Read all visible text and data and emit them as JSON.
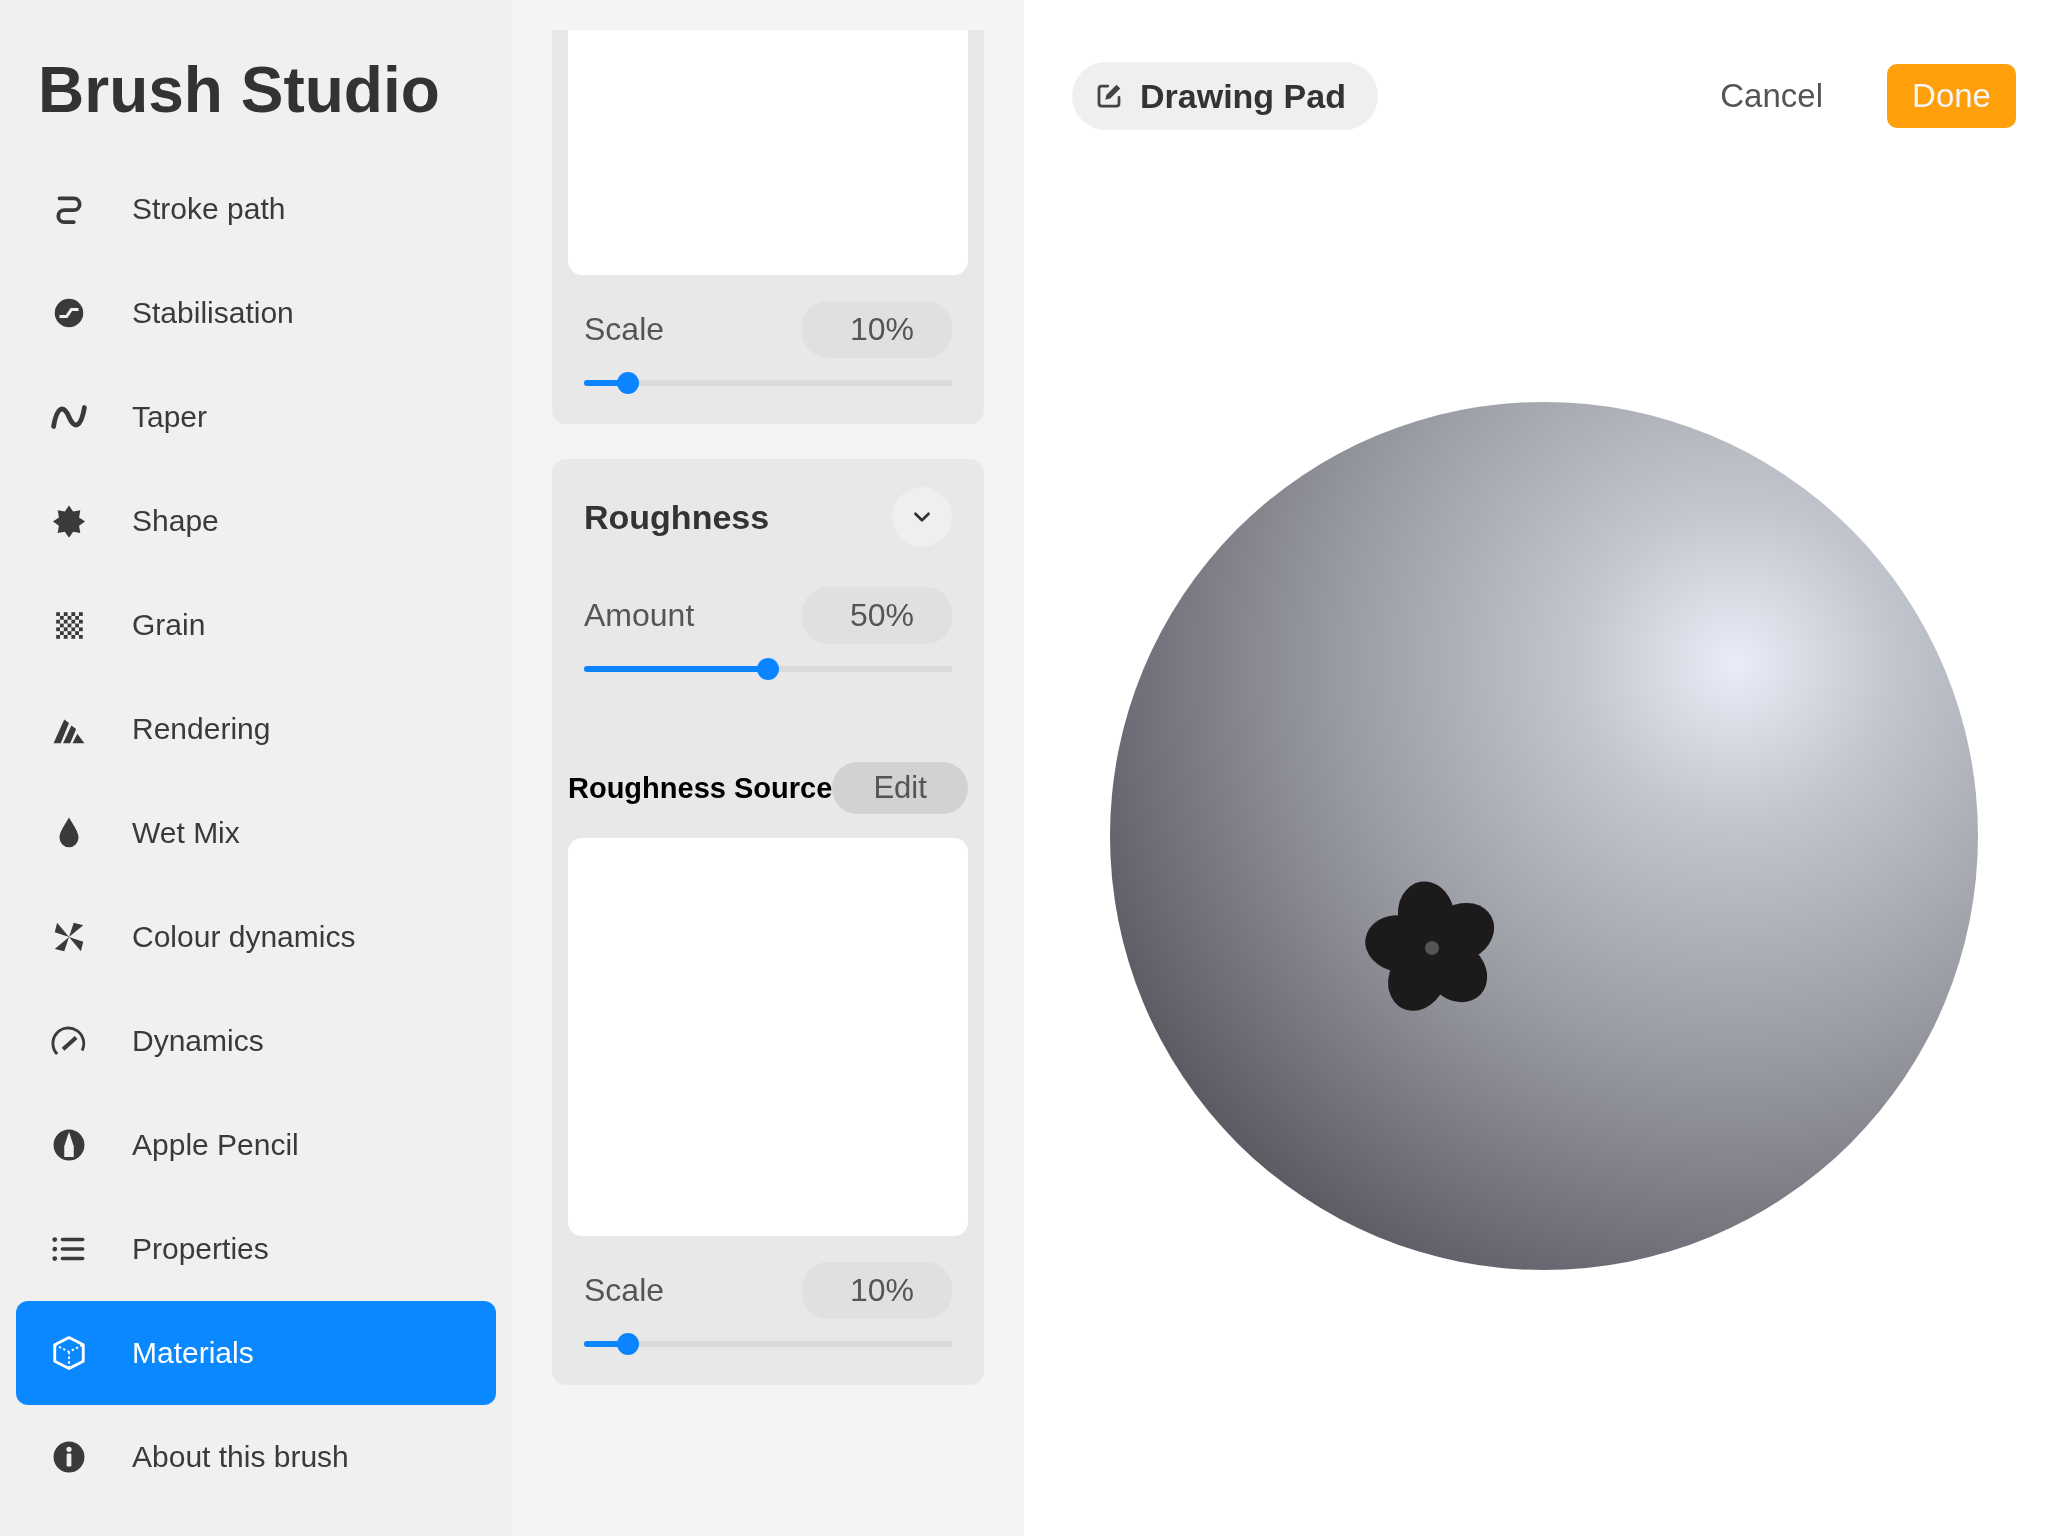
{
  "title": "Brush Studio",
  "sidebar": {
    "items": [
      {
        "label": "Stroke path",
        "selected": false
      },
      {
        "label": "Stabilisation",
        "selected": false
      },
      {
        "label": "Taper",
        "selected": false
      },
      {
        "label": "Shape",
        "selected": false
      },
      {
        "label": "Grain",
        "selected": false
      },
      {
        "label": "Rendering",
        "selected": false
      },
      {
        "label": "Wet Mix",
        "selected": false
      },
      {
        "label": "Colour dynamics",
        "selected": false
      },
      {
        "label": "Dynamics",
        "selected": false
      },
      {
        "label": "Apple Pencil",
        "selected": false
      },
      {
        "label": "Properties",
        "selected": false
      },
      {
        "label": "Materials",
        "selected": true
      },
      {
        "label": "About this brush",
        "selected": false
      }
    ]
  },
  "top_card": {
    "scale": {
      "label": "Scale",
      "value": "10%",
      "level": 0.12
    }
  },
  "roughness": {
    "heading": "Roughness",
    "amount": {
      "label": "Amount",
      "value": "50%",
      "level": 0.5
    },
    "source_label": "Roughness Source",
    "source_action": "Edit",
    "scale": {
      "label": "Scale",
      "value": "10%",
      "level": 0.12
    }
  },
  "preview": {
    "surface_button": "Drawing Pad",
    "cancel": "Cancel",
    "done": "Done"
  }
}
